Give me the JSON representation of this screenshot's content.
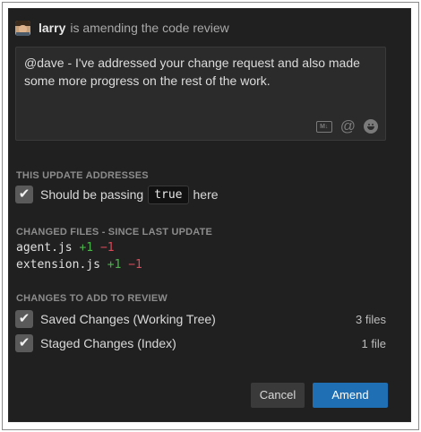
{
  "header": {
    "username": "larry",
    "action_text": "is amending the code review"
  },
  "comment": {
    "text": "@dave - I've addressed your change request and also made some more progress on the rest of the work.",
    "icons": [
      "markdown-icon",
      "mention-icon",
      "emoji-icon"
    ],
    "markdown_label": "M↓"
  },
  "addresses": {
    "title": "THIS UPDATE ADDRESSES",
    "item": {
      "checked": true,
      "text_before": "Should be passing",
      "code": "true",
      "text_after": "here"
    }
  },
  "changed_files": {
    "title": "CHANGED FILES - SINCE LAST UPDATE",
    "files": [
      {
        "name": "agent.js",
        "added": "+1",
        "removed": "−1"
      },
      {
        "name": "extension.js",
        "added": "+1",
        "removed": "−1"
      }
    ]
  },
  "changes_to_add": {
    "title": "CHANGES TO ADD TO REVIEW",
    "items": [
      {
        "checked": true,
        "label": "Saved Changes (Working Tree)",
        "count": "3 files"
      },
      {
        "checked": true,
        "label": "Staged Changes (Index)",
        "count": "1 file"
      }
    ]
  },
  "buttons": {
    "cancel": "Cancel",
    "amend": "Amend"
  },
  "colors": {
    "panel_bg": "#202020",
    "accent": "#1f6fb5",
    "added": "#4cb34c",
    "removed": "#d94a5a"
  }
}
